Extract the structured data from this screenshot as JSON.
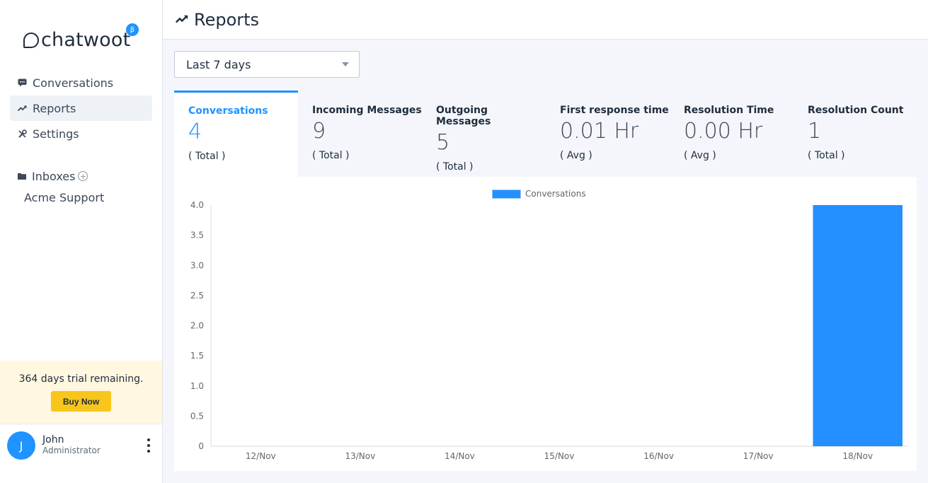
{
  "app": {
    "brand": "chatwoot",
    "beta": "β"
  },
  "sidebar": {
    "items": [
      {
        "label": "Conversations",
        "icon": "chat-icon"
      },
      {
        "label": "Reports",
        "icon": "trending-icon"
      },
      {
        "label": "Settings",
        "icon": "tools-icon"
      }
    ],
    "inboxes_label": "Inboxes",
    "inbox_add": "+",
    "inbox_items": [
      "Acme Support"
    ],
    "trial_text": "364 days trial remaining.",
    "buy_label": "Buy Now",
    "user": {
      "initial": "J",
      "name": "John",
      "role": "Administrator"
    }
  },
  "header": {
    "title": "Reports"
  },
  "filter": {
    "selected": "Last 7 days"
  },
  "metrics": [
    {
      "title": "Conversations",
      "value": "4",
      "desc": "( Total )"
    },
    {
      "title": "Incoming Messages",
      "value": "9",
      "desc": "( Total )"
    },
    {
      "title": "Outgoing Messages",
      "value": "5",
      "desc": "( Total )"
    },
    {
      "title": "First response time",
      "value": "0.01 Hr",
      "desc": "( Avg )"
    },
    {
      "title": "Resolution Time",
      "value": "0.00 Hr",
      "desc": "( Avg )"
    },
    {
      "title": "Resolution Count",
      "value": "1",
      "desc": "( Total )"
    }
  ],
  "colors": {
    "accent": "#1f93ff",
    "bar": "#2490ff",
    "trial_bg": "#fff7e0",
    "buy": "#f8c51c"
  },
  "chart_data": {
    "type": "bar",
    "categories": [
      "12/Nov",
      "13/Nov",
      "14/Nov",
      "15/Nov",
      "16/Nov",
      "17/Nov",
      "18/Nov"
    ],
    "series": [
      {
        "name": "Conversations",
        "values": [
          0,
          0,
          0,
          0,
          0,
          0,
          4
        ]
      }
    ],
    "yticks": [
      "0",
      "0.5",
      "1.0",
      "1.5",
      "2.0",
      "2.5",
      "3.0",
      "3.5",
      "4.0"
    ],
    "ylim": [
      0,
      4
    ],
    "legend": "top-center",
    "grid": false
  }
}
